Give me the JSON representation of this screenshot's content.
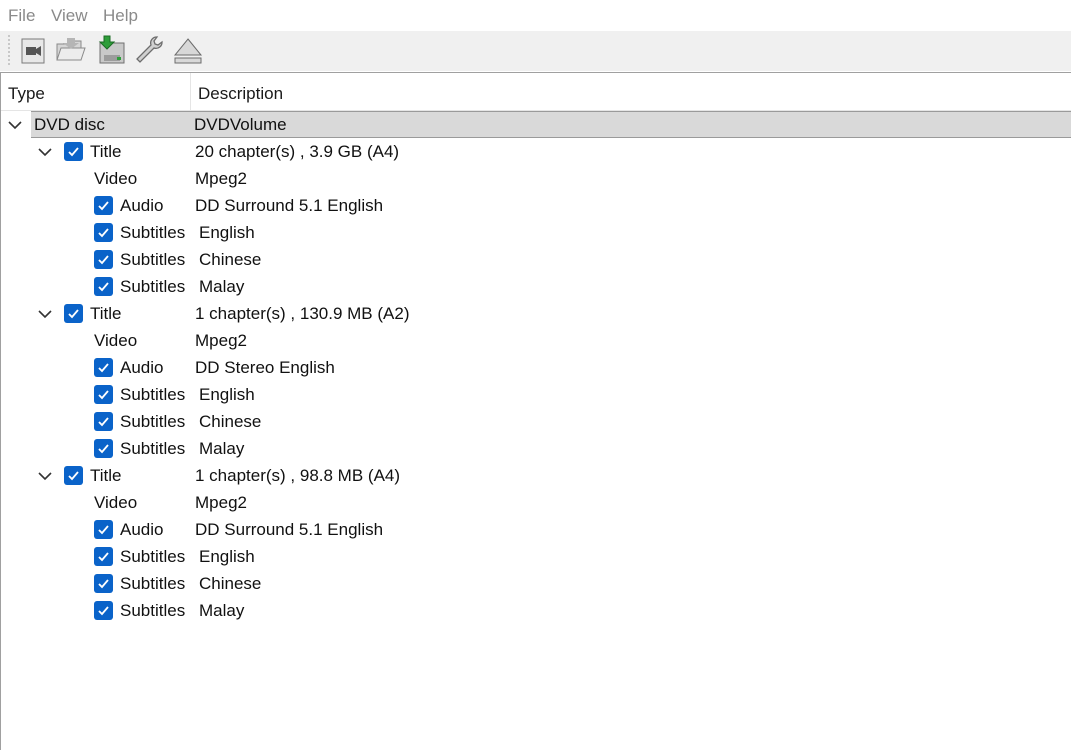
{
  "menu": {
    "file": "File",
    "view": "View",
    "help": "Help"
  },
  "toolbar": {
    "buttons": [
      {
        "icon": "video-camera-icon"
      },
      {
        "icon": "open-folder-icon"
      },
      {
        "icon": "save-disk-icon"
      },
      {
        "icon": "wrench-icon"
      },
      {
        "icon": "eject-icon"
      }
    ]
  },
  "columns": {
    "type": "Type",
    "description": "Description"
  },
  "tree": {
    "root": {
      "type": "DVD disc",
      "description": "DVDVolume"
    },
    "titles": [
      {
        "type": "Title",
        "description": "20 chapter(s) , 3.9 GB (A4)",
        "checked": true,
        "video": {
          "type": "Video",
          "description": "Mpeg2"
        },
        "audio": {
          "type": "Audio",
          "description": "DD Surround 5.1 English",
          "checked": true
        },
        "subtitles": [
          {
            "type": "Subtitles",
            "description": "English",
            "checked": true
          },
          {
            "type": "Subtitles",
            "description": "Chinese",
            "checked": true
          },
          {
            "type": "Subtitles",
            "description": "Malay",
            "checked": true
          }
        ]
      },
      {
        "type": "Title",
        "description": "1 chapter(s) , 130.9 MB (A2)",
        "checked": true,
        "video": {
          "type": "Video",
          "description": "Mpeg2"
        },
        "audio": {
          "type": "Audio",
          "description": "DD Stereo English",
          "checked": true
        },
        "subtitles": [
          {
            "type": "Subtitles",
            "description": "English",
            "checked": true
          },
          {
            "type": "Subtitles",
            "description": "Chinese",
            "checked": true
          },
          {
            "type": "Subtitles",
            "description": "Malay",
            "checked": true
          }
        ]
      },
      {
        "type": "Title",
        "description": "1 chapter(s) , 98.8 MB (A4)",
        "checked": true,
        "video": {
          "type": "Video",
          "description": "Mpeg2"
        },
        "audio": {
          "type": "Audio",
          "description": "DD Surround 5.1 English",
          "checked": true
        },
        "subtitles": [
          {
            "type": "Subtitles",
            "description": "English",
            "checked": true
          },
          {
            "type": "Subtitles",
            "description": "Chinese",
            "checked": true
          },
          {
            "type": "Subtitles",
            "description": "Malay",
            "checked": true
          }
        ]
      }
    ]
  }
}
